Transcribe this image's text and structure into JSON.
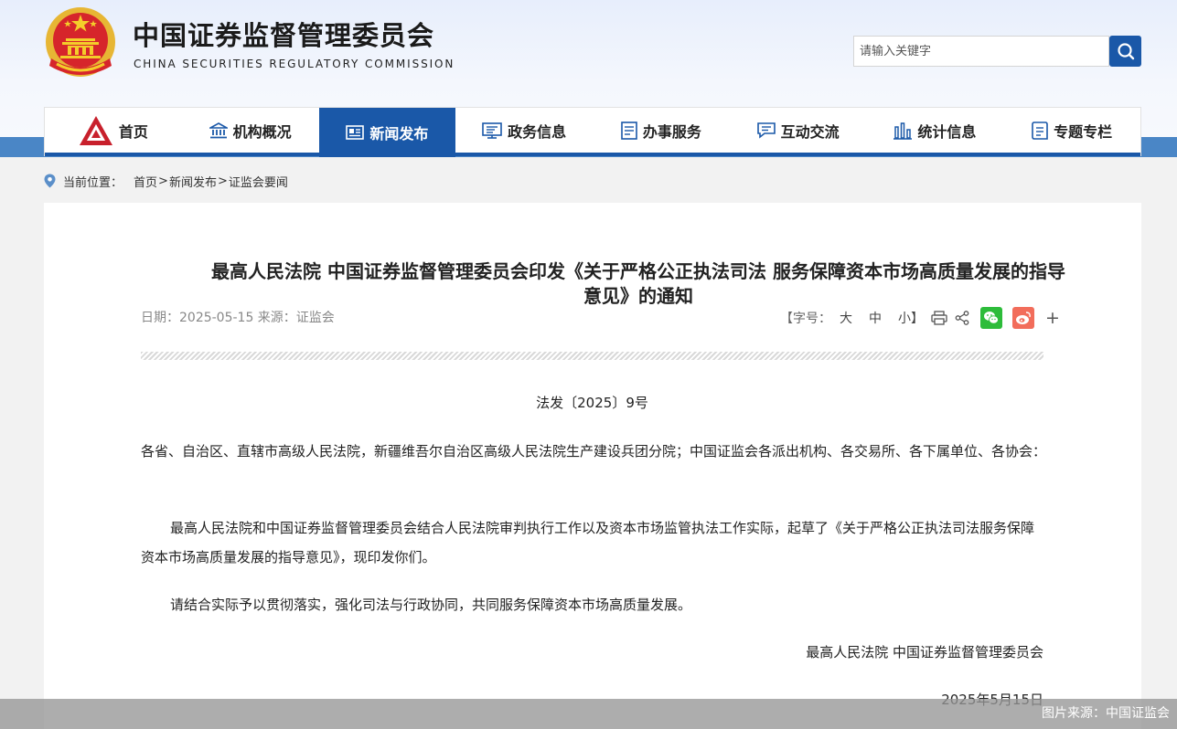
{
  "header": {
    "title_cn": "中国证券监督管理委员会",
    "title_en": "CHINA SECURITIES REGULATORY COMMISSION",
    "search_placeholder": "请输入关键字"
  },
  "nav": {
    "items": [
      {
        "label": "首页",
        "icon": "home-logo-icon"
      },
      {
        "label": "机构概况",
        "icon": "institution-icon"
      },
      {
        "label": "新闻发布",
        "icon": "news-icon",
        "active": true
      },
      {
        "label": "政务信息",
        "icon": "gov-info-icon"
      },
      {
        "label": "办事服务",
        "icon": "service-icon"
      },
      {
        "label": "互动交流",
        "icon": "chat-icon"
      },
      {
        "label": "统计信息",
        "icon": "stats-icon"
      },
      {
        "label": "专题专栏",
        "icon": "topic-icon"
      }
    ]
  },
  "breadcrumb": {
    "label": "当前位置：",
    "items": [
      "首页",
      "新闻发布",
      "证监会要闻"
    ],
    "separator": ">"
  },
  "article": {
    "title_line1": "最高人民法院 中国证券监督管理委员会印发《关于严格公正执法司法 服务保障资本市场高质量发展的指导",
    "title_line2": "意见》的通知",
    "meta": "日期：2025-05-15 来源：证监会",
    "font_size_label": "【字号：",
    "font_large": "大",
    "font_medium": "中",
    "font_small": "小】",
    "doc_number": "法发〔2025〕9号",
    "para1": "各省、自治区、直辖市高级人民法院，新疆维吾尔自治区高级人民法院生产建设兵团分院；中国证监会各派出机构、各交易所、各下属单位、各协会：",
    "para2": "最高人民法院和中国证券监督管理委员会结合人民法院审判执行工作以及资本市场监管执法工作实际，起草了《关于严格公正执法司法服务保障资本市场高质量发展的指导意见》，现印发你们。",
    "para3": "请结合实际予以贯彻落实，强化司法与行政协同，共同服务保障资本市场高质量发展。",
    "signature": "最高人民法院  中国证券监督管理委员会",
    "date": "2025年5月15日"
  },
  "share": {
    "plus": "+"
  },
  "photo_credit": "图片来源：中国证监会",
  "colors": {
    "brand_blue": "#1a58a8",
    "band_blue": "#4a86c6",
    "wechat_green": "#2dbc3a",
    "weibo_red": "#f26d5b"
  }
}
